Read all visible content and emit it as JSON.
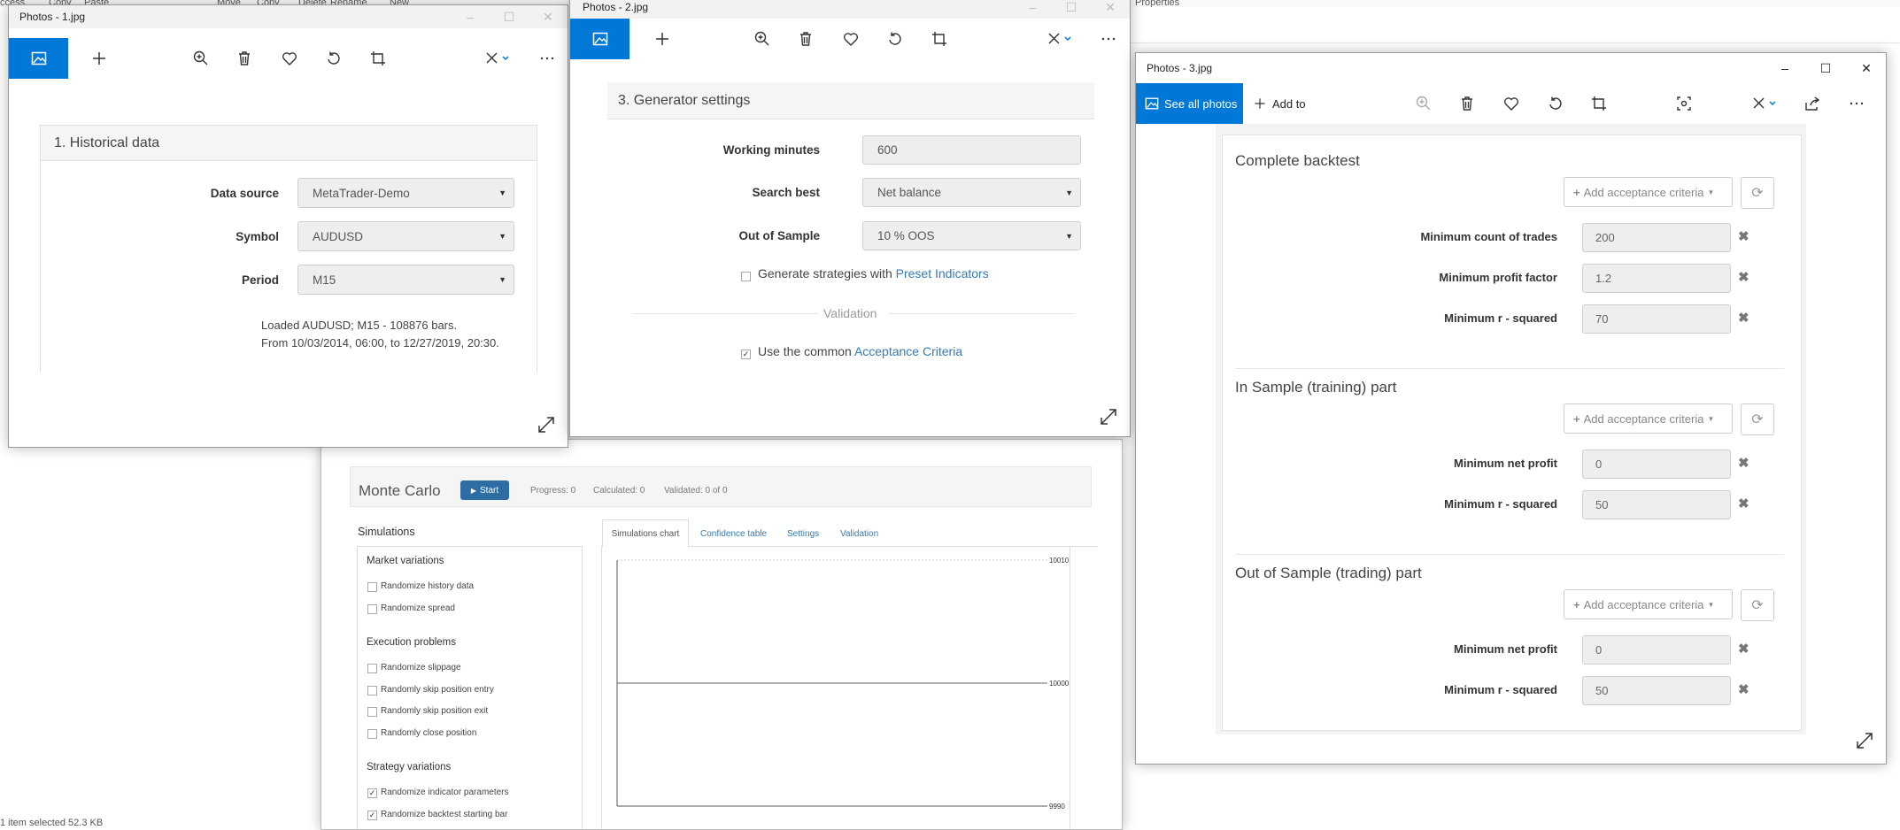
{
  "explorer": {
    "menu_items": [
      "Move",
      "Copy",
      "Delete",
      "Rename",
      "New",
      "Properties"
    ],
    "top_left_labels": [
      "ccess",
      "Copy",
      "Paste"
    ],
    "status_text": "1 item selected  52.3 KB"
  },
  "window1": {
    "title": "Photos - 1.jpg",
    "panel_title": "1. Historical data",
    "fields": [
      {
        "label": "Data source",
        "value": "MetaTrader-Demo"
      },
      {
        "label": "Symbol",
        "value": "AUDUSD"
      },
      {
        "label": "Period",
        "value": "M15"
      }
    ],
    "info_line1": "Loaded AUDUSD; M15 - 108876 bars.",
    "info_line2": "From 10/03/2014, 06:00, to 12/27/2019, 20:30."
  },
  "window2": {
    "title": "Photos - 2.jpg",
    "panel_title": "3. Generator settings",
    "fields": [
      {
        "label": "Working minutes",
        "value": "600"
      },
      {
        "label": "Search best",
        "value": "Net balance"
      },
      {
        "label": "Out of Sample",
        "value": "10 % OOS"
      }
    ],
    "generate_prefix": "Generate strategies with ",
    "generate_link": "Preset Indicators",
    "validation_label": "Validation",
    "acceptance_prefix": "Use the common ",
    "acceptance_link": "Acceptance Criteria"
  },
  "window3": {
    "title": "Photos - 3.jpg",
    "see_all_label": "See all photos",
    "add_to_label": "Add to",
    "add_criteria_label": "Add acceptance criteria",
    "sections": [
      {
        "title": "Complete backtest",
        "rows": [
          {
            "label": "Minimum count of trades",
            "value": "200"
          },
          {
            "label": "Minimum profit factor",
            "value": "1.2"
          },
          {
            "label": "Minimum r - squared",
            "value": "70"
          }
        ]
      },
      {
        "title": "In Sample (training) part",
        "rows": [
          {
            "label": "Minimum net profit",
            "value": "0"
          },
          {
            "label": "Minimum r - squared",
            "value": "50"
          }
        ]
      },
      {
        "title": "Out of Sample (trading) part",
        "rows": [
          {
            "label": "Minimum net profit",
            "value": "0"
          },
          {
            "label": "Minimum r - squared",
            "value": "50"
          }
        ]
      }
    ]
  },
  "monte_carlo": {
    "title": "Monte Carlo",
    "start_label": "Start",
    "progress": "Progress: 0",
    "calculated": "Calculated: 0",
    "validated": "Validated: 0 of 0",
    "simulations_heading": "Simulations",
    "groups": [
      {
        "name": "Market variations",
        "items": [
          {
            "label": "Randomize history data",
            "checked": false
          },
          {
            "label": "Randomize spread",
            "checked": false
          }
        ]
      },
      {
        "name": "Execution problems",
        "items": [
          {
            "label": "Randomize slippage",
            "checked": false
          },
          {
            "label": "Randomly skip position entry",
            "checked": false
          },
          {
            "label": "Randomly skip position exit",
            "checked": false
          },
          {
            "label": "Randomly close position",
            "checked": false
          }
        ]
      },
      {
        "name": "Strategy variations",
        "items": [
          {
            "label": "Randomize indicator parameters",
            "checked": true
          },
          {
            "label": "Randomize backtest starting bar",
            "checked": true
          }
        ]
      }
    ],
    "tabs": [
      "Simulations chart",
      "Confidence table",
      "Settings",
      "Validation"
    ],
    "y_labels": [
      "10010",
      "10000",
      "9990"
    ]
  },
  "chart_data": {
    "type": "line",
    "y_tick_labels": [
      "10010",
      "10000",
      "9990"
    ],
    "ylim": [
      9990,
      10010
    ],
    "series": [
      {
        "values": [
          10000,
          10000
        ]
      }
    ]
  }
}
